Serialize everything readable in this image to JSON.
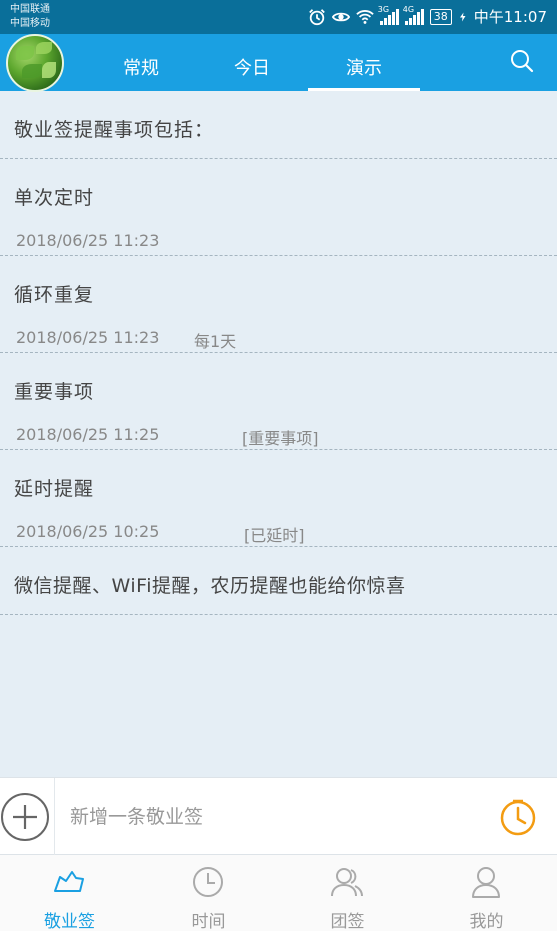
{
  "status_bar": {
    "carrier_1": "中国联通",
    "carrier_2": "中国移动",
    "signal_1_label": "3G",
    "signal_2_label": "4G",
    "battery": "38",
    "time": "中午11:07"
  },
  "tabs": [
    {
      "label": "常规"
    },
    {
      "label": "今日"
    },
    {
      "label": "演示",
      "active": true
    }
  ],
  "intro": "敬业签提醒事项包括：",
  "items": [
    {
      "title": "单次定时",
      "date": "2018/06/25  11:23",
      "tag": ""
    },
    {
      "title": "循环重复",
      "date": "2018/06/25  11:23",
      "tag": "每1天"
    },
    {
      "title": "重要事项",
      "date": "2018/06/25  11:25",
      "tag": "[重要事项]"
    },
    {
      "title": "延时提醒",
      "date": "2018/06/25  10:25",
      "tag": "[已延时]"
    }
  ],
  "last_item": "微信提醒、WiFi提醒，农历提醒也能给你惊喜",
  "input": {
    "placeholder": "新增一条敬业签"
  },
  "bottom_nav": [
    {
      "label": "敬业签",
      "icon": "note-icon",
      "active": true
    },
    {
      "label": "时间",
      "icon": "clock-icon"
    },
    {
      "label": "团签",
      "icon": "group-icon"
    },
    {
      "label": "我的",
      "icon": "person-icon"
    }
  ],
  "colors": {
    "primary": "#1aa0e2",
    "status_bar": "#0a6f9a",
    "background": "#e5eef5",
    "accent_clock": "#f39c12"
  }
}
